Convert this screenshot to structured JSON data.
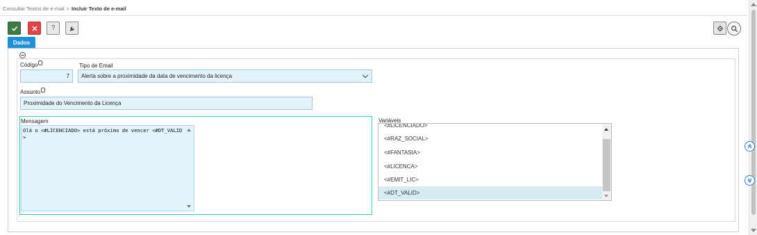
{
  "breadcrumb": {
    "parent": "Consultar Textos de e-mail",
    "separator": ">",
    "current": "Incluir Texto de e-mail"
  },
  "toolbar": {
    "confirm_icon": "check-icon",
    "cancel_icon": "close-icon",
    "help_label": "?",
    "tools_icon": "wrench-icon",
    "settings_icon": "gear-icon",
    "search_icon": "search-icon"
  },
  "tabs": [
    {
      "label": "Dados",
      "active": true
    }
  ],
  "form": {
    "codigo": {
      "label": "Código",
      "value": "7"
    },
    "tipo_email": {
      "label": "Tipo de Email",
      "value": "Alerta sobre a proximidade da data de vencimento da licença"
    },
    "assunto": {
      "label": "Assunto",
      "value": "Proximidade do Vencimento da Licença"
    },
    "mensagem": {
      "label": "Mensagem",
      "value": "Olá o <#LICENCIADO> está próximo de vencer <#DT_VALID>"
    },
    "variaveis": {
      "label": "Variáveis",
      "items": [
        "<#LICENCIADO>",
        "<#RAZ_SOCIAL>",
        "<#FANTASIA>",
        "<#LICENCA>",
        "<#EMIT_LIC>",
        "<#DT_VALID>"
      ],
      "selected": "<#DT_VALID>"
    }
  },
  "side_buttons": {
    "scroll_up_icon": "double-chevron-up-icon",
    "scroll_down_icon": "double-chevron-down-icon"
  },
  "colors": {
    "confirm": "#3d7a45",
    "cancel": "#e04545",
    "tab_active": "#1e90d8",
    "field_bg": "#e3f3fb",
    "focus_border": "#27d7a8"
  }
}
